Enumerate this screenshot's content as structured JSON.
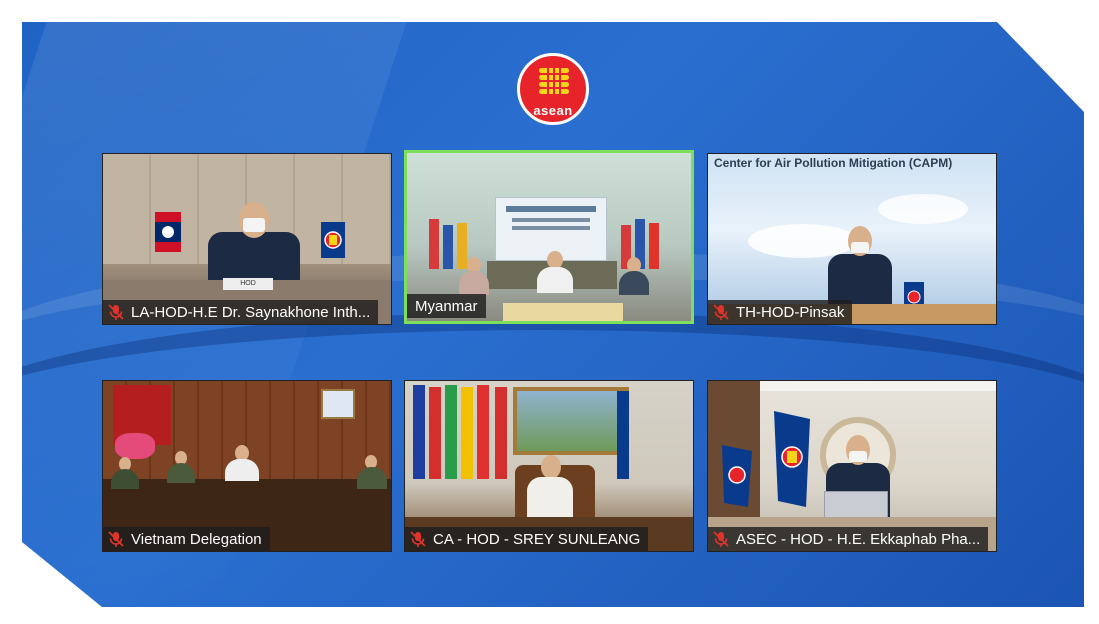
{
  "logo": {
    "text": "asean",
    "icon": "asean-sheaf-icon"
  },
  "tiles": [
    {
      "id": "laos",
      "label": "LA-HOD-H.E Dr. Saynakhone Inth...",
      "muted": true,
      "active": false
    },
    {
      "id": "myanmar",
      "label": "Myanmar",
      "muted": false,
      "active": true
    },
    {
      "id": "thailand",
      "label": "TH-HOD-Pinsak",
      "muted": true,
      "active": false,
      "banner": "Center for Air Pollution Mitigation (CAPM)"
    },
    {
      "id": "vietnam",
      "label": "Vietnam Delegation",
      "muted": true,
      "active": false
    },
    {
      "id": "cambodia",
      "label": "CA - HOD - SREY SUNLEANG",
      "muted": true,
      "active": false
    },
    {
      "id": "asec",
      "label": "ASEC - HOD - H.E. Ekkaphab Pha...",
      "muted": true,
      "active": false
    }
  ],
  "colors": {
    "background": "#1f63c4",
    "active_border": "#7ee05a",
    "muted_icon": "#e0342b"
  }
}
